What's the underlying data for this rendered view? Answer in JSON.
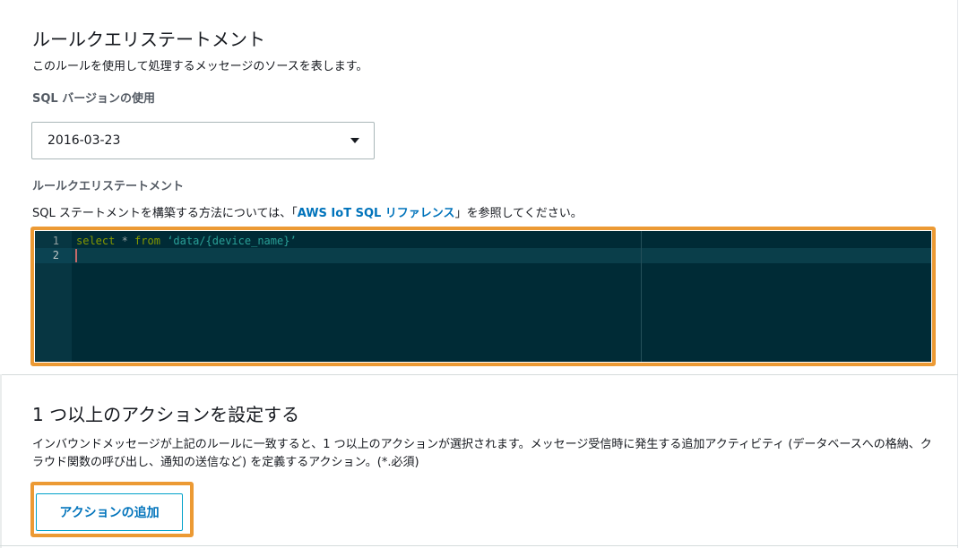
{
  "rule_query": {
    "title": "ルールクエリステートメント",
    "description": "このルールを使用して処理するメッセージのソースを表します。",
    "sql_version_label": "SQL バージョンの使用",
    "sql_version_value": "2016-03-23",
    "statement_label": "ルールクエリステートメント",
    "help_prefix": "SQL ステートメントを構築する方法については、「",
    "help_link": "AWS IoT SQL リファレンス",
    "help_suffix": "」を参照してください。",
    "editor": {
      "line_numbers": [
        "1",
        "2"
      ],
      "code_keyword_select": "select",
      "code_star": " * ",
      "code_keyword_from": "from",
      "code_space": " ",
      "code_string": "‘data/{device_name}’"
    }
  },
  "actions": {
    "title": "1 つ以上のアクションを設定する",
    "description": "インバウンドメッセージが上記のルールに一致すると、1 つ以上のアクションが選択されます。メッセージ受信時に発生する追加アクティビティ (データベースへの格納、クラウド関数の呼び出し、通知の送信など) を定義するアクション。(*.必須)",
    "add_button_label": "アクションの追加"
  },
  "colors": {
    "highlight": "#ec9a34",
    "link": "#0073bb",
    "editor_bg": "#002b36"
  }
}
